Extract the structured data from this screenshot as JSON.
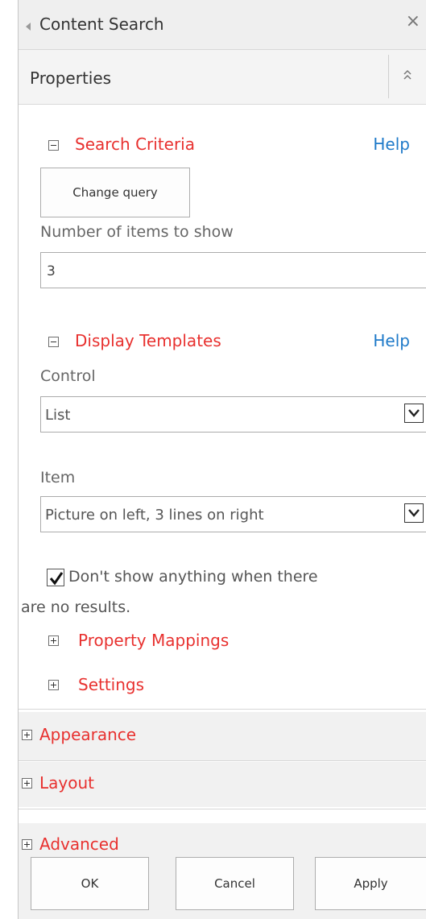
{
  "title_bar": {
    "title": "Content Search",
    "close_glyph": "×"
  },
  "properties_bar": {
    "label": "Properties"
  },
  "search_criteria": {
    "title": "Search Criteria",
    "help": "Help",
    "change_query_label": "Change query",
    "items_label": "Number of items to show",
    "items_value": "3"
  },
  "display_templates": {
    "title": "Display Templates",
    "help": "Help",
    "control_label": "Control",
    "control_value": "List",
    "item_label": "Item",
    "item_value": "Picture on left, 3 lines on right",
    "hide_checkbox_line1": "Don't show anything when there",
    "hide_checkbox_line2": "are no results.",
    "hide_checked": true
  },
  "sub_sections": {
    "property_mappings": "Property Mappings",
    "settings": "Settings"
  },
  "outer_sections": {
    "appearance": "Appearance",
    "layout": "Layout",
    "advanced": "Advanced"
  },
  "footer": {
    "ok": "OK",
    "cancel": "Cancel",
    "apply": "Apply"
  },
  "colors": {
    "section_title": "#e8312f",
    "help_link": "#1f7ac9",
    "chrome_background": "#f1f1f1"
  }
}
